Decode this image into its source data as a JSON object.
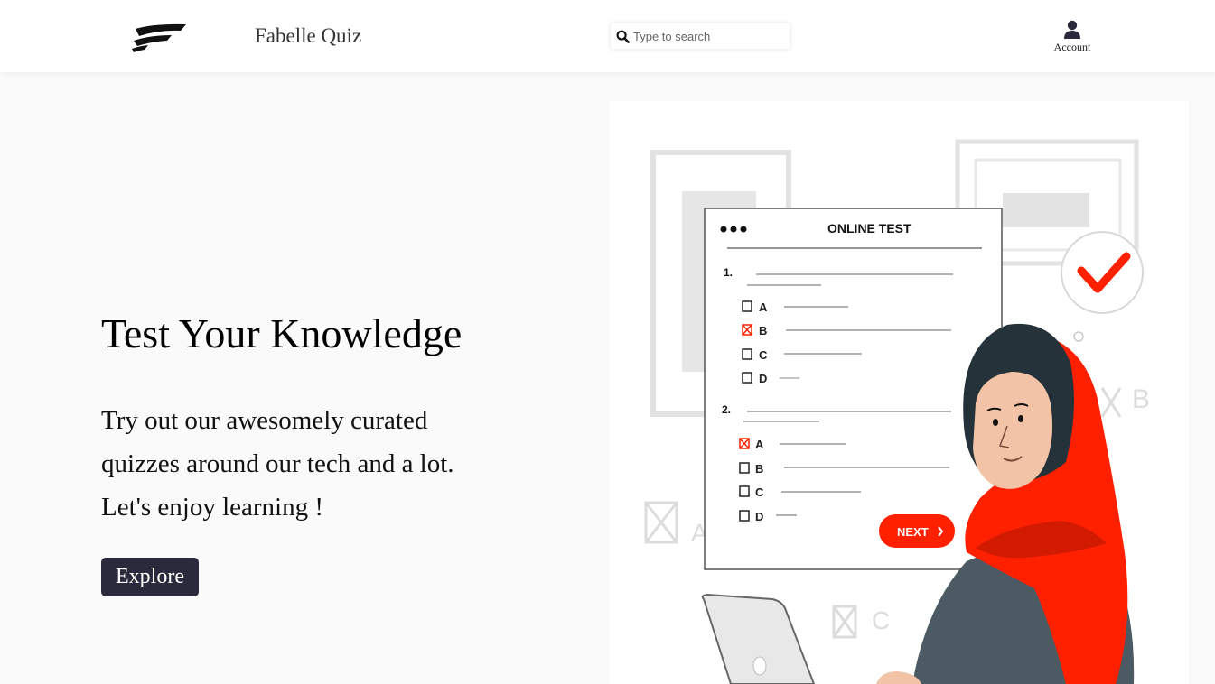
{
  "navbar": {
    "brand": "Fabelle Quiz",
    "logo_icon": "fabelle-logo-icon",
    "search": {
      "placeholder": "Type to search",
      "value": "",
      "icon": "search-icon"
    },
    "account": {
      "label": "Account",
      "icon": "user-icon"
    }
  },
  "hero": {
    "title": "Test Your Knowledge",
    "line1": "Try out our awesomely curated",
    "line2": "quizzes around our tech and a lot.",
    "line3": "Let's enjoy learning !",
    "cta_label": "Explore",
    "cta_color": "#2b2a3d"
  },
  "illustration": {
    "heading": "ONLINE TEST",
    "q1_number": "1.",
    "q2_number": "2.",
    "options": [
      "A",
      "B",
      "C",
      "D"
    ],
    "next_label": "NEXT",
    "accent_color": "#ff2000",
    "bg_letters": [
      "B",
      "A",
      "C"
    ]
  }
}
